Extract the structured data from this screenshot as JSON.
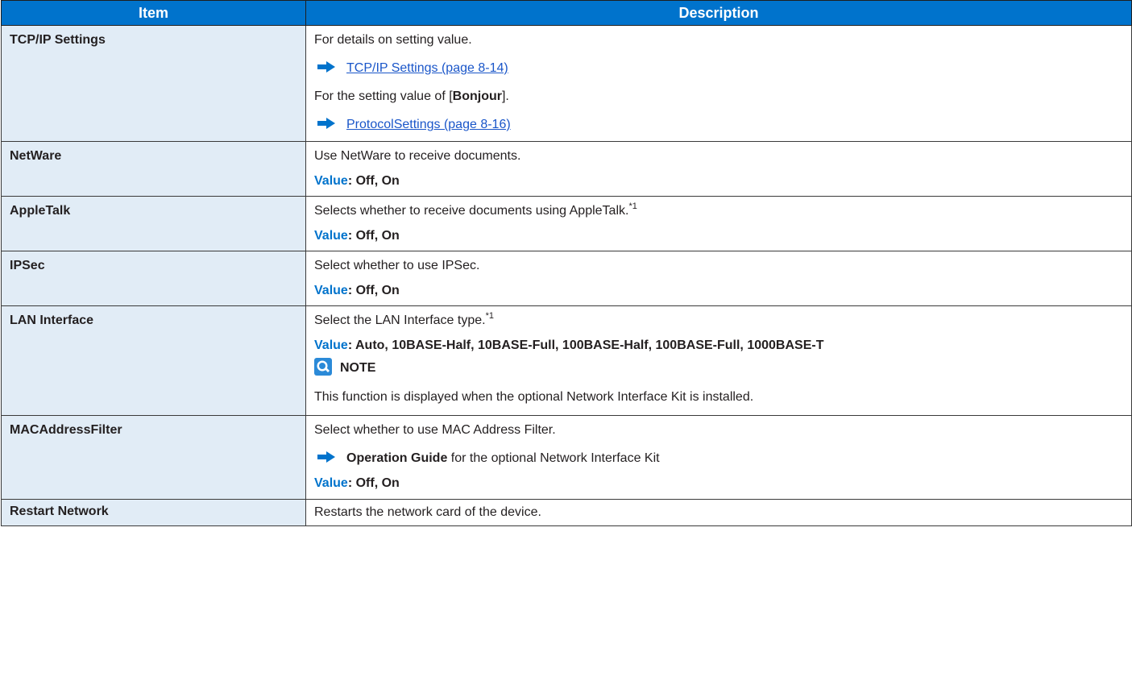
{
  "header": {
    "item": "Item",
    "description": "Description"
  },
  "rows": {
    "tcpip": {
      "item": "TCP/IP Settings",
      "line1": "For details on setting value.",
      "link1": "TCP/IP Settings (page 8-14)",
      "line2_pre": "For the setting value of [",
      "line2_bold": "Bonjour",
      "line2_post": "].",
      "link2": "ProtocolSettings (page 8-16)"
    },
    "netware": {
      "item": "NetWare",
      "desc": "Use NetWare to receive documents.",
      "value_label": "Value",
      "value": ": Off, On"
    },
    "appletalk": {
      "item": "AppleTalk",
      "desc": "Selects whether to receive documents using AppleTalk.",
      "footnote": "*1",
      "value_label": "Value",
      "value": ": Off, On"
    },
    "ipsec": {
      "item": "IPSec",
      "desc": "Select whether to use IPSec.",
      "value_label": "Value",
      "value": ": Off, On"
    },
    "lan": {
      "item": "LAN Interface",
      "desc": "Select the LAN Interface type.",
      "footnote": "*1",
      "value_label": "Value",
      "value": ": Auto, 10BASE-Half, 10BASE-Full, 100BASE-Half, 100BASE-Full, 1000BASE-T",
      "note_title": "NOTE",
      "note_text": "This function is displayed when the optional Network Interface Kit is installed."
    },
    "mac": {
      "item": "MACAddressFilter",
      "desc": "Select whether to use MAC Address Filter.",
      "ref_bold": "Operation Guide",
      "ref_text": " for the optional Network Interface Kit",
      "value_label": "Value",
      "value": ": Off, On"
    },
    "restart": {
      "item": "Restart Network",
      "desc": "Restarts the network card of the device."
    }
  },
  "colors": {
    "header_bg": "#0073cc",
    "item_bg": "#e1ecf6",
    "value_label": "#0073cc",
    "link": "#1a56c9"
  }
}
